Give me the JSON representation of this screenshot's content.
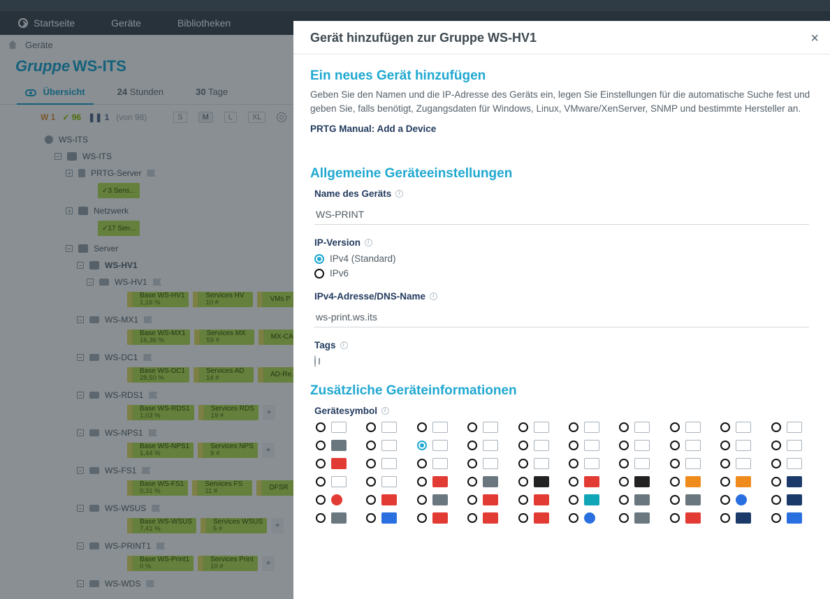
{
  "nav": {
    "home": "Startseite",
    "devices": "Geräte",
    "libraries": "Bibliotheken"
  },
  "breadcrumb": {
    "item": "Geräte"
  },
  "group_header": {
    "prefix": "Gruppe",
    "name": "WS-ITS"
  },
  "tabs": {
    "overview": "Übersicht",
    "t24n": "24",
    "t24l": "Stunden",
    "t30n": "30",
    "t30l": "Tage"
  },
  "status": {
    "w": "1",
    "ok": "96",
    "pause": "1",
    "of": "(von 98)",
    "s": "S",
    "m": "M",
    "l": "L",
    "xl": "XL"
  },
  "tree": {
    "root": "WS-ITS",
    "probe": "WS-ITS",
    "prtg": "PRTG-Server",
    "prtg_sens": "3 Sens...",
    "net": "Netzwerk",
    "net_sens": "17 Sen...",
    "server": "Server",
    "hv1": "WS-HV1",
    "hv1d": "WS-HV1",
    "hv1_s": [
      {
        "n": "Base WS-HV1",
        "v": "1,16 %"
      },
      {
        "n": "Services HV",
        "v": "10 #"
      },
      {
        "n": "VMs P",
        "v": ""
      }
    ],
    "mx1": "WS-MX1",
    "mx1_s": [
      {
        "n": "Base WS-MX1",
        "v": "16,36 %"
      },
      {
        "n": "Services MX",
        "v": "59 #"
      },
      {
        "n": "MX-CA",
        "v": ""
      }
    ],
    "dc1": "WS-DC1",
    "dc1_s": [
      {
        "n": "Base WS-DC1",
        "v": "28,50 %"
      },
      {
        "n": "Services AD",
        "v": "14 #"
      },
      {
        "n": "AD-Re...",
        "v": ""
      }
    ],
    "rds1": "WS-RDS1",
    "rds1_s": [
      {
        "n": "Base WS-RDS1",
        "v": "1,03 %"
      },
      {
        "n": "Services RDS",
        "v": "19 #"
      }
    ],
    "nps1": "WS-NPS1",
    "nps1_s": [
      {
        "n": "Base WS-NPS1",
        "v": "1,44 %"
      },
      {
        "n": "Services NPS",
        "v": "9 #"
      }
    ],
    "fs1": "WS-FS1",
    "fs1_s": [
      {
        "n": "Base WS-FS1",
        "v": "0,31 %"
      },
      {
        "n": "Services FS",
        "v": "11 #"
      },
      {
        "n": "DFSR",
        "v": ""
      }
    ],
    "wsus": "WS-WSUS",
    "wsus_s": [
      {
        "n": "Base WS-WSUS",
        "v": "7,41 %"
      },
      {
        "n": "Services WSUS",
        "v": "5 #"
      }
    ],
    "print1": "WS-PRINT1",
    "print1_s": [
      {
        "n": "Base WS-Print1",
        "v": "0 %"
      },
      {
        "n": "Services Print",
        "v": "10 #"
      }
    ],
    "wds": "WS-WDS"
  },
  "modal": {
    "title": "Gerät hinzufügen zur Gruppe WS-HV1",
    "sub": "Ein neues Gerät hinzufügen",
    "desc": "Geben Sie den Namen und die IP-Adresse des Geräts ein, legen Sie Einstellungen für die automatische Suche fest und geben Sie, falls benötigt, Zugangsdaten für Windows, Linux, VMware/XenServer, SNMP und bestimmte Hersteller an.",
    "manual": "PRTG Manual: Add a Device",
    "sec1": "Allgemeine Geräteeinstellungen",
    "name_label": "Name des Geräts",
    "name_value": "WS-PRINT",
    "ipver_label": "IP-Version",
    "ipver_v4": "IPv4 (Standard)",
    "ipver_v6": "IPv6",
    "addr_label": "IPv4-Adresse/DNS-Name",
    "addr_value": "ws-print.ws.its",
    "tags_label": "Tags",
    "sec2": "Zusätzliche Geräteinformationen",
    "icon_label": "Gerätesymbol"
  },
  "icons": [
    {
      "cls": ""
    },
    {
      "cls": ""
    },
    {
      "cls": ""
    },
    {
      "cls": ""
    },
    {
      "cls": ""
    },
    {
      "cls": ""
    },
    {
      "cls": ""
    },
    {
      "cls": ""
    },
    {
      "cls": ""
    },
    {
      "cls": ""
    },
    {
      "cls": "brand b-grey"
    },
    {
      "cls": ""
    },
    {
      "cls": "",
      "sel": true
    },
    {
      "cls": ""
    },
    {
      "cls": ""
    },
    {
      "cls": ""
    },
    {
      "cls": ""
    },
    {
      "cls": ""
    },
    {
      "cls": ""
    },
    {
      "cls": ""
    },
    {
      "cls": "brand b-red"
    },
    {
      "cls": ""
    },
    {
      "cls": ""
    },
    {
      "cls": ""
    },
    {
      "cls": ""
    },
    {
      "cls": ""
    },
    {
      "cls": ""
    },
    {
      "cls": ""
    },
    {
      "cls": ""
    },
    {
      "cls": ""
    },
    {
      "cls": ""
    },
    {
      "cls": ""
    },
    {
      "cls": "brand b-red"
    },
    {
      "cls": "brand b-grey"
    },
    {
      "cls": "brand b-black"
    },
    {
      "cls": "brand b-red"
    },
    {
      "cls": "brand b-black"
    },
    {
      "cls": "brand b-orange"
    },
    {
      "cls": "brand b-orange"
    },
    {
      "cls": "brand b-darkblue"
    },
    {
      "cls": "brand b-red circle"
    },
    {
      "cls": "brand b-red"
    },
    {
      "cls": "brand b-grey"
    },
    {
      "cls": "brand b-red"
    },
    {
      "cls": "brand b-red"
    },
    {
      "cls": "brand b-teal"
    },
    {
      "cls": "brand b-grey"
    },
    {
      "cls": "brand b-grey"
    },
    {
      "cls": "brand b-blue circle"
    },
    {
      "cls": "brand b-darkblue"
    },
    {
      "cls": "brand b-grey"
    },
    {
      "cls": "brand b-blue"
    },
    {
      "cls": "brand b-red"
    },
    {
      "cls": "brand b-red"
    },
    {
      "cls": "brand b-red"
    },
    {
      "cls": "brand b-blue circle"
    },
    {
      "cls": "brand b-grey"
    },
    {
      "cls": "brand b-red"
    },
    {
      "cls": "brand b-darkblue"
    },
    {
      "cls": "brand b-blue"
    }
  ]
}
